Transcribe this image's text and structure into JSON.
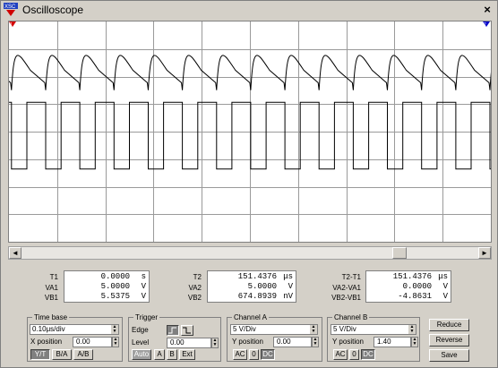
{
  "window": {
    "title": "Oscilloscope",
    "close_glyph": "×",
    "icon": "oscilloscope-app-icon"
  },
  "colors": {
    "trace": "#000000",
    "grid": "#9a9a9a",
    "screen": "#ffffff",
    "cursor1": "#d40000",
    "cursor2": "#0000c8",
    "face": "#d4d0c8"
  },
  "scrollbar": {
    "left_glyph": "◄",
    "right_glyph": "►",
    "position": 0.8
  },
  "readouts": {
    "col1": {
      "labels": [
        "T1",
        "VA1",
        "VB1"
      ],
      "values": [
        "0.0000",
        "5.0000",
        "5.5375"
      ],
      "units": [
        "s",
        "V",
        "V"
      ]
    },
    "col2": {
      "labels": [
        "T2",
        "VA2",
        "VB2"
      ],
      "values": [
        "151.4376",
        "5.0000",
        "674.8939"
      ],
      "units": [
        "μs",
        "V",
        "nV"
      ]
    },
    "col3": {
      "labels": [
        "T2-T1",
        "VA2-VA1",
        "VB2-VB1"
      ],
      "values": [
        "151.4376",
        "0.0000",
        "-4.8631"
      ],
      "units": [
        "μs",
        "V",
        "V"
      ]
    }
  },
  "timebase": {
    "title": "Time base",
    "scale": "0.10μs/div",
    "xpos_label": "X position",
    "xpos": "0.00",
    "buttons": [
      "Y/T",
      "B/A",
      "A/B"
    ]
  },
  "trigger": {
    "title": "Trigger",
    "edge_label": "Edge",
    "level_label": "Level",
    "level": "0.00",
    "buttons": [
      "Auto",
      "A",
      "B",
      "Ext"
    ]
  },
  "channel_a": {
    "title": "Channel A",
    "scale": "5 V/Div",
    "ypos_label": "Y position",
    "ypos": "0.00",
    "coupling": [
      "AC",
      "0",
      "DC"
    ]
  },
  "channel_b": {
    "title": "Channel B",
    "scale": "5 V/Div",
    "ypos_label": "Y position",
    "ypos": "1.40",
    "coupling": [
      "AC",
      "0",
      "DC"
    ]
  },
  "side_buttons": [
    "Reduce",
    "Reverse",
    "Save"
  ],
  "chart_data": {
    "type": "line",
    "series": [
      {
        "waveform": "rc-spike",
        "periods": 15
      },
      {
        "waveform": "square",
        "periods": 15,
        "high": 5,
        "low": 0
      }
    ],
    "grid": true
  }
}
